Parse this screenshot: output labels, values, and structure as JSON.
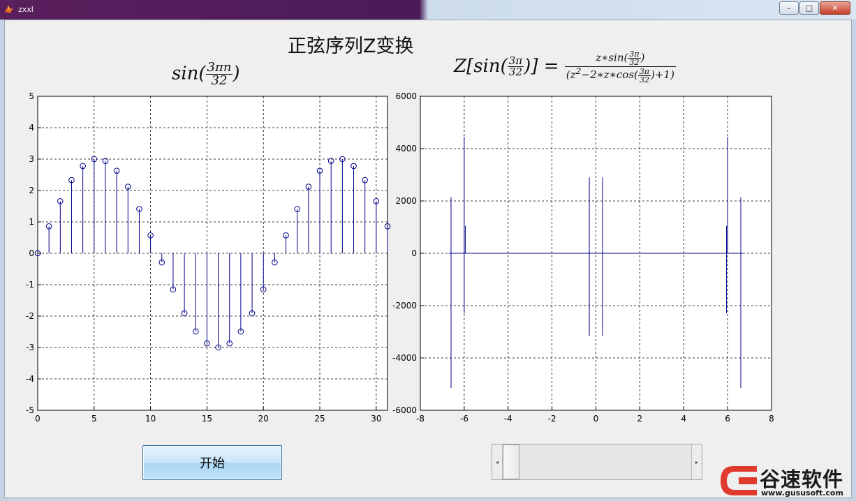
{
  "window": {
    "title": "zxxl",
    "min_label": "–",
    "max_label": "□",
    "close_label": "✕"
  },
  "figure": {
    "title": "正弦序列Z变换",
    "left_eq": {
      "prefix": "sin(",
      "num": "3πn",
      "den": "32",
      "suffix": ")"
    },
    "right_eq": {
      "lhs_prefix": "Z[sin(",
      "lhs_num": "3π",
      "lhs_den": "32",
      "lhs_suffix": ")] =",
      "rhs_num_prefix": "z∗sin(",
      "rhs_num_num": "3π",
      "rhs_num_den": "32",
      "rhs_num_suffix": ")",
      "rhs_den_prefix": "(z",
      "rhs_den_exp": "2",
      "rhs_den_mid": "−2∗z∗cos(",
      "rhs_den_num": "3π",
      "rhs_den_den": "32",
      "rhs_den_suffix": ")+1)"
    }
  },
  "chart_data": [
    {
      "type": "stem",
      "n": [
        0,
        1,
        2,
        3,
        4,
        5,
        6,
        7,
        8,
        9,
        10,
        11,
        12,
        13,
        14,
        15,
        16,
        17,
        18,
        19,
        20,
        21,
        22,
        23,
        24,
        25,
        26,
        27,
        28,
        29,
        30,
        31
      ],
      "values": [
        0,
        0.86,
        1.66,
        2.33,
        2.78,
        3.0,
        2.94,
        2.63,
        2.12,
        1.41,
        0.57,
        -0.29,
        -1.15,
        -1.91,
        -2.49,
        -2.87,
        -3.0,
        -2.87,
        -2.49,
        -1.91,
        -1.15,
        -0.29,
        0.57,
        1.41,
        2.12,
        2.63,
        2.94,
        3.0,
        2.78,
        2.33,
        1.66,
        0.86
      ],
      "xlim": [
        0,
        31
      ],
      "ylim": [
        -5,
        5
      ],
      "xticks": [
        0,
        5,
        10,
        15,
        20,
        25,
        30
      ],
      "yticks": [
        5,
        4,
        3,
        2,
        1,
        0,
        -1,
        -2,
        -3,
        -4,
        -5
      ],
      "grid": true,
      "color": "#00008b",
      "marker": "circle"
    },
    {
      "type": "line",
      "xlim": [
        -8,
        8
      ],
      "ylim": [
        -6000,
        6000
      ],
      "xticks": [
        -8,
        -6,
        -4,
        -2,
        0,
        2,
        4,
        6,
        8
      ],
      "yticks": [
        6000,
        4000,
        2000,
        0,
        -2000,
        -4000,
        -6000
      ],
      "grid": true,
      "color": "#00008b",
      "spikes": [
        {
          "x": -6.6,
          "y": 2150
        },
        {
          "x": -6.6,
          "y": -5150
        },
        {
          "x": -6.0,
          "y": 4450
        },
        {
          "x": -6.0,
          "y": -2300
        },
        {
          "x": -5.95,
          "y": 1050
        },
        {
          "x": -0.3,
          "y": 2900
        },
        {
          "x": -0.3,
          "y": -3150
        },
        {
          "x": 0.3,
          "y": 2900
        },
        {
          "x": 0.3,
          "y": -3150
        },
        {
          "x": 5.95,
          "y": 1050
        },
        {
          "x": 5.95,
          "y": -2300
        },
        {
          "x": 6.0,
          "y": 4450
        },
        {
          "x": 6.6,
          "y": 2150
        },
        {
          "x": 6.6,
          "y": -5150
        }
      ],
      "baseline_range": [
        -6.7,
        6.7
      ]
    }
  ],
  "controls": {
    "start_button": "开始",
    "slider_left": "◂",
    "slider_right": "▸"
  },
  "watermark": {
    "brand": "谷速软件",
    "url": "www.gususoft.com",
    "accent": "#e03a2f"
  }
}
